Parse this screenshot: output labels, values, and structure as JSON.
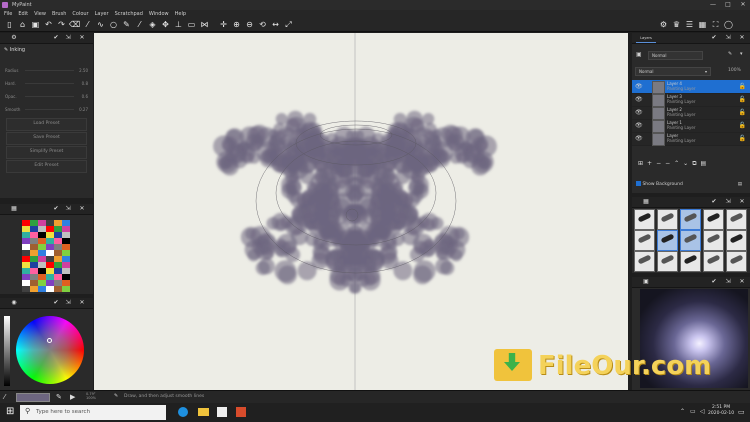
{
  "window": {
    "title": "MyPaint",
    "min": "—",
    "max": "□",
    "close": "✕"
  },
  "menu": [
    "File",
    "Edit",
    "View",
    "Brush",
    "Colour",
    "Layer",
    "Scratchpad",
    "Window",
    "Help"
  ],
  "toolbar_icons": [
    "new-document",
    "open",
    "save",
    "undo",
    "redo",
    "eraser",
    "brush",
    "lasso",
    "ellipse",
    "pen",
    "ink",
    "fill",
    "clone",
    "stamp",
    "rectangle",
    "symmetry",
    "transform",
    "zoom-in",
    "zoom-out",
    "flip",
    "rotate",
    "fullscreen"
  ],
  "toolbar_right_icons": [
    "settings",
    "brush-settings",
    "layers",
    "palette",
    "fullscreen",
    "reset"
  ],
  "brush_panel": {
    "brush_name": "Inking",
    "sliders": [
      {
        "label": "Radius",
        "value": "2.50"
      },
      {
        "label": "Hard.",
        "value": "0.8"
      },
      {
        "label": "Opac.",
        "value": "0.6"
      },
      {
        "label": "Smooth",
        "value": "0.27"
      }
    ],
    "buttons": [
      "Load Preset",
      "Save Preset",
      "Simplify Preset",
      "Edit Preset"
    ]
  },
  "palette_panel": {
    "title": "Palette"
  },
  "wheel_panel": {
    "title": "Colour Wheel"
  },
  "layers_panel": {
    "tab": "Layers",
    "mode": "Normal",
    "blend": "Normal",
    "opacity": "100%",
    "layers": [
      {
        "name": "Layer 4",
        "sub": "Painting Layer",
        "selected": true
      },
      {
        "name": "Layer 3",
        "sub": "Painting Layer",
        "selected": false
      },
      {
        "name": "Layer 2",
        "sub": "Painting Layer",
        "selected": false
      },
      {
        "name": "Layer 1",
        "sub": "Painting Layer",
        "selected": false
      },
      {
        "name": "Layer",
        "sub": "Painting Layer",
        "selected": false
      }
    ],
    "show_background": "Show Background"
  },
  "brushes_panel": {
    "brushes": [
      "pencil",
      "charcoal",
      "ink",
      "airbrush",
      "marker",
      "knife",
      "pen",
      "blend",
      "smudge",
      "splatter",
      "chalk",
      "blot",
      "dry",
      "bristle",
      "sponge"
    ]
  },
  "preview_panel": {
    "title": "Preview"
  },
  "statusbar": {
    "zoom_line1": "0.79°",
    "zoom_line2": "100%",
    "hint": "Draw, and then adjust smooth lines"
  },
  "taskbar": {
    "search_placeholder": "Type here to search",
    "time": "2:51 PM",
    "date": "2020-02-10"
  },
  "watermark": {
    "text": "FileOur.com"
  },
  "colors": {
    "accent": "#1f6fd1",
    "canvas": "#edede6",
    "blob": "#6d6680"
  }
}
